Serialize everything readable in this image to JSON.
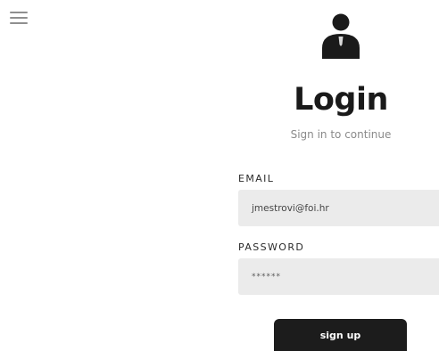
{
  "header": {
    "menu_icon": "hamburger-menu-icon",
    "user_icon": "user-profile-icon"
  },
  "login": {
    "title": "Login",
    "subtitle": "Sign in to continue",
    "email_label": "EMAIL",
    "email_value": "jmestrovi@foi.hr",
    "password_label": "PASSWORD",
    "password_value": "******",
    "signup_button": "sign up"
  },
  "colors": {
    "background": "#ffffff",
    "text_dark": "#1a1a1a",
    "subtitle": "#8a8a8a",
    "field_bg": "#ebebeb",
    "button_bg": "#1c1c1c",
    "button_text": "#ffffff"
  }
}
